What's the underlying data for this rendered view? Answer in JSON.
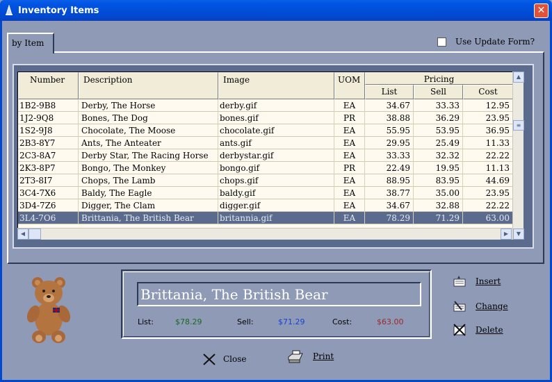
{
  "window": {
    "title": "Inventory Items",
    "close_glyph": "✕"
  },
  "tab": {
    "label": "by Item"
  },
  "update_form": {
    "label": "Use Update Form?",
    "checked": false
  },
  "grid": {
    "headers": {
      "number": "Number",
      "description": "Description",
      "image": "Image",
      "uom": "UOM",
      "pricing": "Pricing",
      "list": "List",
      "sell": "Sell",
      "cost": "Cost"
    },
    "rows": [
      {
        "number": "1B2-9B8",
        "description": "Derby, The Horse",
        "image": "derby.gif",
        "uom": "EA",
        "list": "34.67",
        "sell": "33.33",
        "cost": "12.95"
      },
      {
        "number": "1J2-9Q8",
        "description": "Bones, The Dog",
        "image": "bones.gif",
        "uom": "PR",
        "list": "38.88",
        "sell": "36.29",
        "cost": "23.95"
      },
      {
        "number": "1S2-9J8",
        "description": "Chocolate, The Moose",
        "image": "chocolate.gif",
        "uom": "EA",
        "list": "55.95",
        "sell": "53.95",
        "cost": "36.95"
      },
      {
        "number": "2B3-8Y7",
        "description": "Ants, The Anteater",
        "image": "ants.gif",
        "uom": "EA",
        "list": "29.95",
        "sell": "25.49",
        "cost": "11.33"
      },
      {
        "number": "2C3-8A7",
        "description": "Derby Star, The Racing Horse",
        "image": "derbystar.gif",
        "uom": "EA",
        "list": "33.33",
        "sell": "32.32",
        "cost": "22.22"
      },
      {
        "number": "2K3-8P7",
        "description": "Bongo, The Monkey",
        "image": "bongo.gif",
        "uom": "PR",
        "list": "22.49",
        "sell": "19.95",
        "cost": "11.13"
      },
      {
        "number": "2T3-8I7",
        "description": "Chops, The Lamb",
        "image": "chops.gif",
        "uom": "EA",
        "list": "88.95",
        "sell": "83.95",
        "cost": "44.69"
      },
      {
        "number": "3C4-7X6",
        "description": "Baldy, The Eagle",
        "image": "baldy.gif",
        "uom": "EA",
        "list": "38.77",
        "sell": "35.00",
        "cost": "23.95"
      },
      {
        "number": "3D4-7Z6",
        "description": "Digger, The Clam",
        "image": "digger.gif",
        "uom": "EA",
        "list": "34.67",
        "sell": "32.88",
        "cost": "22.22"
      },
      {
        "number": "3L4-7O6",
        "description": "Brittania, The British Bear",
        "image": "britannia.gif",
        "uom": "EA",
        "list": "78.29",
        "sell": "71.29",
        "cost": "63.00",
        "selected": true
      }
    ]
  },
  "detail": {
    "name": "Brittania, The British Bear",
    "list_label": "List:",
    "list_value": "$78.29",
    "sell_label": "Sell:",
    "sell_value": "$71.29",
    "cost_label": "Cost:",
    "cost_value": "$63.00",
    "colors": {
      "list": "#1a6a1a",
      "sell": "#1a3fd8",
      "cost": "#a02828"
    }
  },
  "buttons": {
    "insert": "Insert",
    "change": "Change",
    "delete": "Delete",
    "close": "Close",
    "print": "Print"
  },
  "icons": [
    "app-icon",
    "close-icon",
    "checkbox-icon",
    "teddy-bear-image",
    "insert-icon",
    "change-icon",
    "delete-icon",
    "close-x-icon",
    "printer-icon",
    "scroll-up-icon",
    "scroll-down-icon",
    "scroll-left-icon",
    "scroll-right-icon"
  ]
}
